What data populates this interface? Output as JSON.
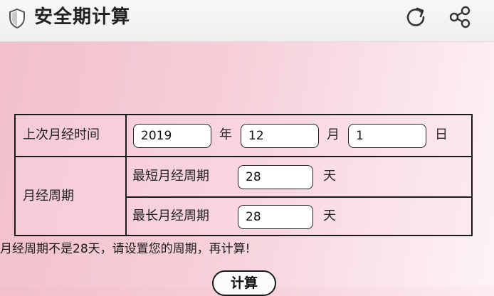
{
  "header": {
    "title": "安全期计算",
    "icons": {
      "left": "shield-icon",
      "refresh": "refresh-icon",
      "share": "share-icon"
    }
  },
  "form": {
    "last_period": {
      "label": "上次月经时间",
      "year_value": "2019",
      "year_unit": "年",
      "month_value": "12",
      "month_unit": "月",
      "day_value": "1",
      "day_unit": "日"
    },
    "cycle": {
      "label": "月经周期",
      "shortest": {
        "label": "最短月经周期",
        "value": "28",
        "unit": "天"
      },
      "longest": {
        "label": "最长月经周期",
        "value": "28",
        "unit": "天"
      }
    }
  },
  "hint": "月经周期不是28天，请设置您的周期，再计算!",
  "actions": {
    "calculate_label": "计算"
  },
  "colors": {
    "background": "#f6cfd9",
    "header": "#f3f3f3",
    "border": "#1a1a1a"
  }
}
